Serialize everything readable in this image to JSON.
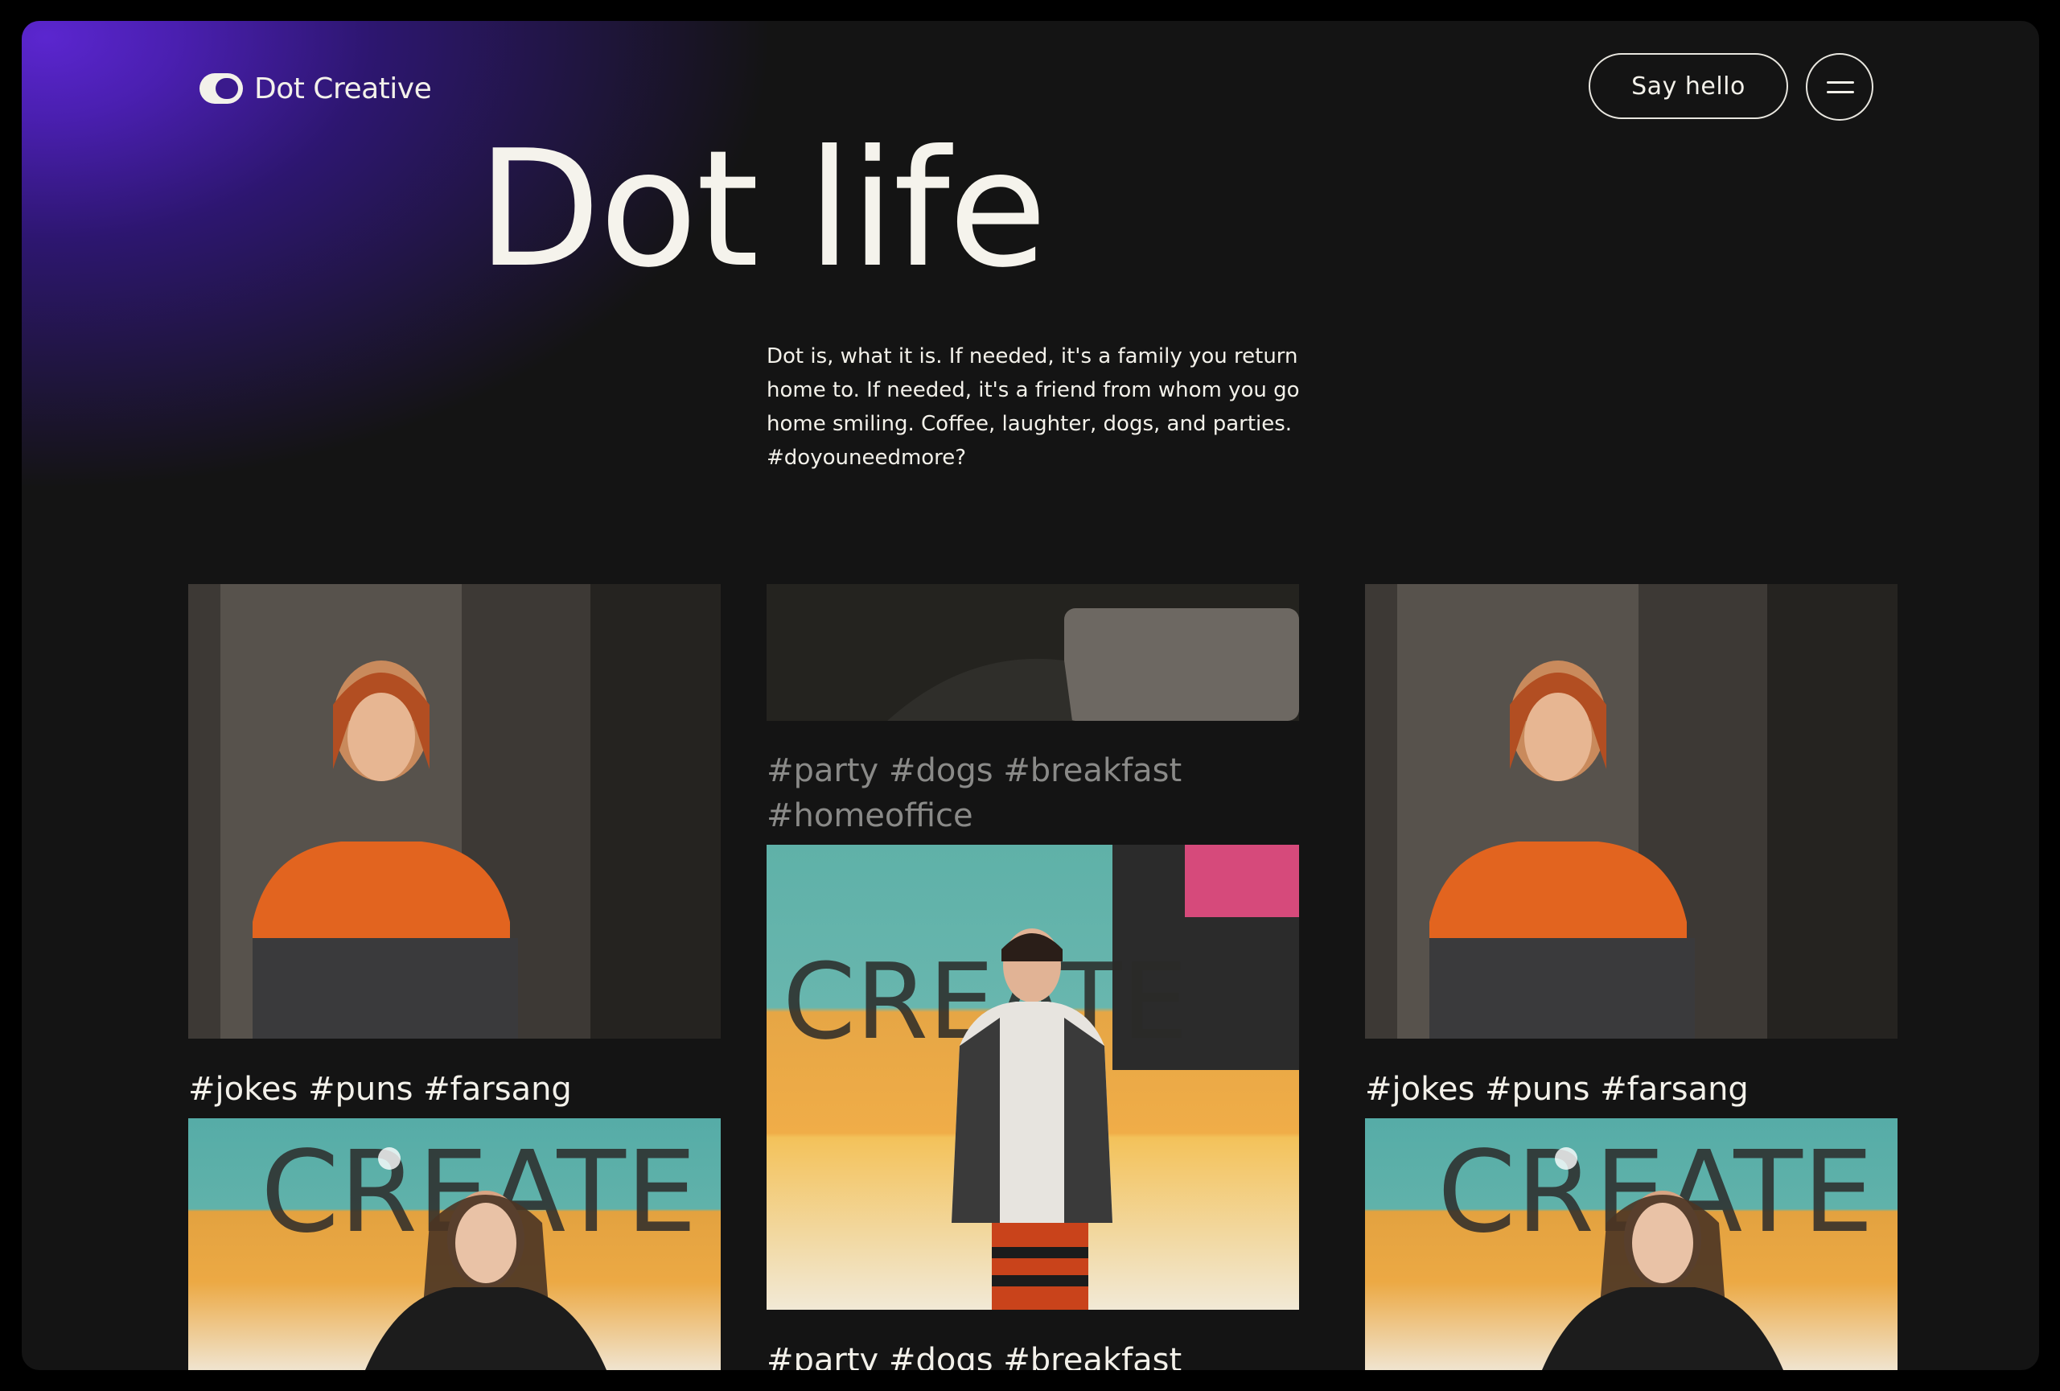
{
  "brand": {
    "name": "Dot Creative",
    "icon": "dot-logo-icon"
  },
  "header": {
    "cta_label": "Say hello",
    "menu_icon": "hamburger-menu-icon"
  },
  "hero": {
    "title": "Dot life",
    "intro": "Dot is, what it is. If needed, it's a family you return home to. If needed, it's a friend from whom you go home smiling. Coffee, laughter, dogs, and parties. #doyouneedmore?"
  },
  "gallery": {
    "col1": [
      {
        "tags": "#jokes #puns #farsang"
      }
    ],
    "col2": [
      {
        "tags": "#party #dogs #breakfast #homeoffice"
      },
      {
        "tags": "#party #dogs #breakfast"
      }
    ],
    "col3": [
      {
        "tags": "#jokes #puns #farsang"
      }
    ]
  },
  "colors": {
    "background": "#141414",
    "text": "#f3f1ea",
    "accent": "#5b26cf"
  }
}
